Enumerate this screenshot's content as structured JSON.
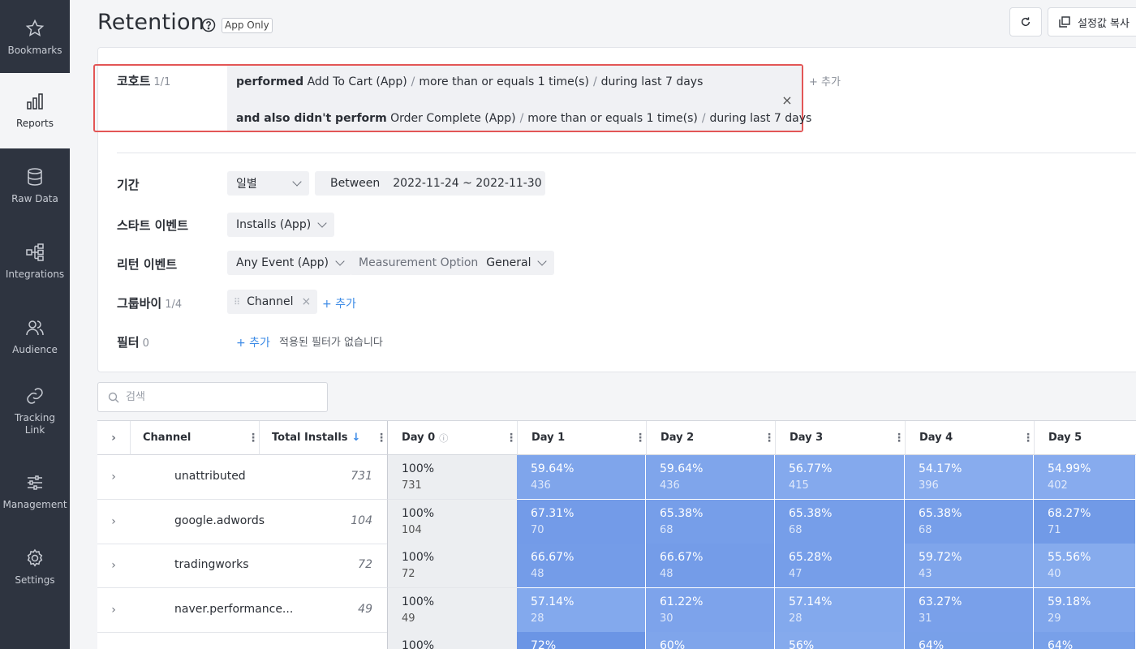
{
  "sidebar": {
    "items": [
      {
        "label": "Bookmarks",
        "icon": "star-icon"
      },
      {
        "label": "Reports",
        "icon": "bar-chart-icon"
      },
      {
        "label": "Raw Data",
        "icon": "database-icon"
      },
      {
        "label": "Integrations",
        "icon": "integrations-icon"
      },
      {
        "label": "Audience",
        "icon": "users-icon"
      },
      {
        "label": "Tracking Link",
        "icon": "link-icon"
      },
      {
        "label": "Management",
        "icon": "sliders-icon"
      },
      {
        "label": "Settings",
        "icon": "gear-icon"
      }
    ]
  },
  "header": {
    "title": "Retention",
    "badge": "App Only",
    "copy_label": "설정값 복사"
  },
  "cohort": {
    "label": "코호트",
    "count": "1/1",
    "cond1": {
      "verb": "performed",
      "event": "Add To Cart (App)",
      "freq": "more than or equals 1 time(s)",
      "period": "during last 7 days"
    },
    "cond2": {
      "verb": "and also didn't perform",
      "event": "Order Complete (App)",
      "freq": "more than or equals 1 time(s)",
      "period": "during last 7 days"
    },
    "add_label": "+ 추가",
    "close_label": "×"
  },
  "period": {
    "label": "기간",
    "unit": "일별",
    "mode": "Between",
    "range": "2022-11-24 ~ 2022-11-30"
  },
  "start_event": {
    "label": "스타트 이벤트",
    "value": "Installs (App)"
  },
  "return_event": {
    "label": "리턴 이벤트",
    "value": "Any Event (App)",
    "option_label": "Measurement Option",
    "option_value": "General"
  },
  "groupby": {
    "label": "그룹바이",
    "count": "1/4",
    "chip": "Channel",
    "chip_close": "×",
    "add_label": "+ 추가"
  },
  "filter": {
    "label": "필터",
    "count": "0",
    "add_label": "+ 추가",
    "empty_text": "적용된 필터가 없습니다"
  },
  "search": {
    "placeholder": "검색"
  },
  "table": {
    "headers": {
      "channel": "Channel",
      "total": "Total Installs",
      "days": [
        "Day 0",
        "Day 1",
        "Day 2",
        "Day 3",
        "Day 4",
        "Day 5"
      ]
    },
    "rows": [
      {
        "channel": "unattributed",
        "total": "731",
        "cells": [
          [
            "100%",
            "731"
          ],
          [
            "59.64%",
            "436"
          ],
          [
            "59.64%",
            "436"
          ],
          [
            "56.77%",
            "415"
          ],
          [
            "54.17%",
            "396"
          ],
          [
            "54.99%",
            "402"
          ]
        ]
      },
      {
        "channel": "google.adwords",
        "total": "104",
        "cells": [
          [
            "100%",
            "104"
          ],
          [
            "67.31%",
            "70"
          ],
          [
            "65.38%",
            "68"
          ],
          [
            "65.38%",
            "68"
          ],
          [
            "65.38%",
            "68"
          ],
          [
            "68.27%",
            "71"
          ]
        ]
      },
      {
        "channel": "tradingworks",
        "total": "72",
        "cells": [
          [
            "100%",
            "72"
          ],
          [
            "66.67%",
            "48"
          ],
          [
            "66.67%",
            "48"
          ],
          [
            "65.28%",
            "47"
          ],
          [
            "59.72%",
            "43"
          ],
          [
            "55.56%",
            "40"
          ]
        ]
      },
      {
        "channel": "naver.performance...",
        "total": "49",
        "cells": [
          [
            "100%",
            "49"
          ],
          [
            "57.14%",
            "28"
          ],
          [
            "61.22%",
            "30"
          ],
          [
            "57.14%",
            "28"
          ],
          [
            "63.27%",
            "31"
          ],
          [
            "59.18%",
            "29"
          ]
        ]
      },
      {
        "channel": "",
        "total": "",
        "cells": [
          [
            "100%",
            ""
          ],
          [
            "72%",
            ""
          ],
          [
            "60%",
            ""
          ],
          [
            "56%",
            ""
          ],
          [
            "64%",
            ""
          ],
          [
            "64%",
            ""
          ]
        ]
      }
    ]
  },
  "colors": {
    "sidebar_bg": "#2e3440",
    "accent": "#3b8ae6",
    "highlight_border": "#e35656",
    "retention_cell": "#7ea3ea"
  }
}
